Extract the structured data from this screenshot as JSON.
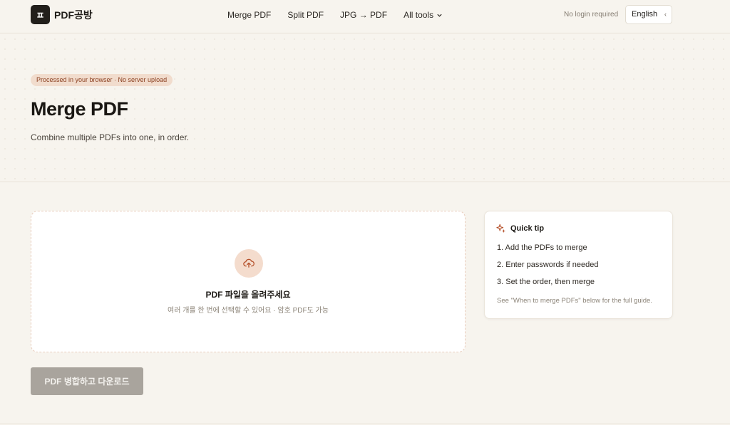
{
  "brand": {
    "mark": "ㅍ",
    "name": "PDF공방"
  },
  "nav": {
    "items": [
      "Merge PDF",
      "Split PDF",
      "JPG → PDF"
    ],
    "all_tools": "All tools"
  },
  "header": {
    "no_login": "No login required",
    "language": "English",
    "language_caret": "‹"
  },
  "hero": {
    "badge": "Processed in your browser · No server upload",
    "title": "Merge PDF",
    "subtitle": "Combine multiple PDFs into one, in order."
  },
  "dropzone": {
    "title": "PDF 파일을 올려주세요",
    "subtitle": "여러 개를 한 번에 선택할 수 있어요 · 암호 PDF도 가능"
  },
  "tip": {
    "heading": "Quick tip",
    "steps": [
      "1. Add the PDFs to merge",
      "2. Enter passwords if needed",
      "3. Set the order, then merge"
    ],
    "note": "See \"When to merge PDFs\" below for the full guide."
  },
  "action": {
    "merge_label": "PDF 병합하고 다운로드"
  },
  "colors": {
    "accent": "#b5502a",
    "badge_bg": "#f1dccd",
    "disabled_button": "#a9a49d"
  }
}
